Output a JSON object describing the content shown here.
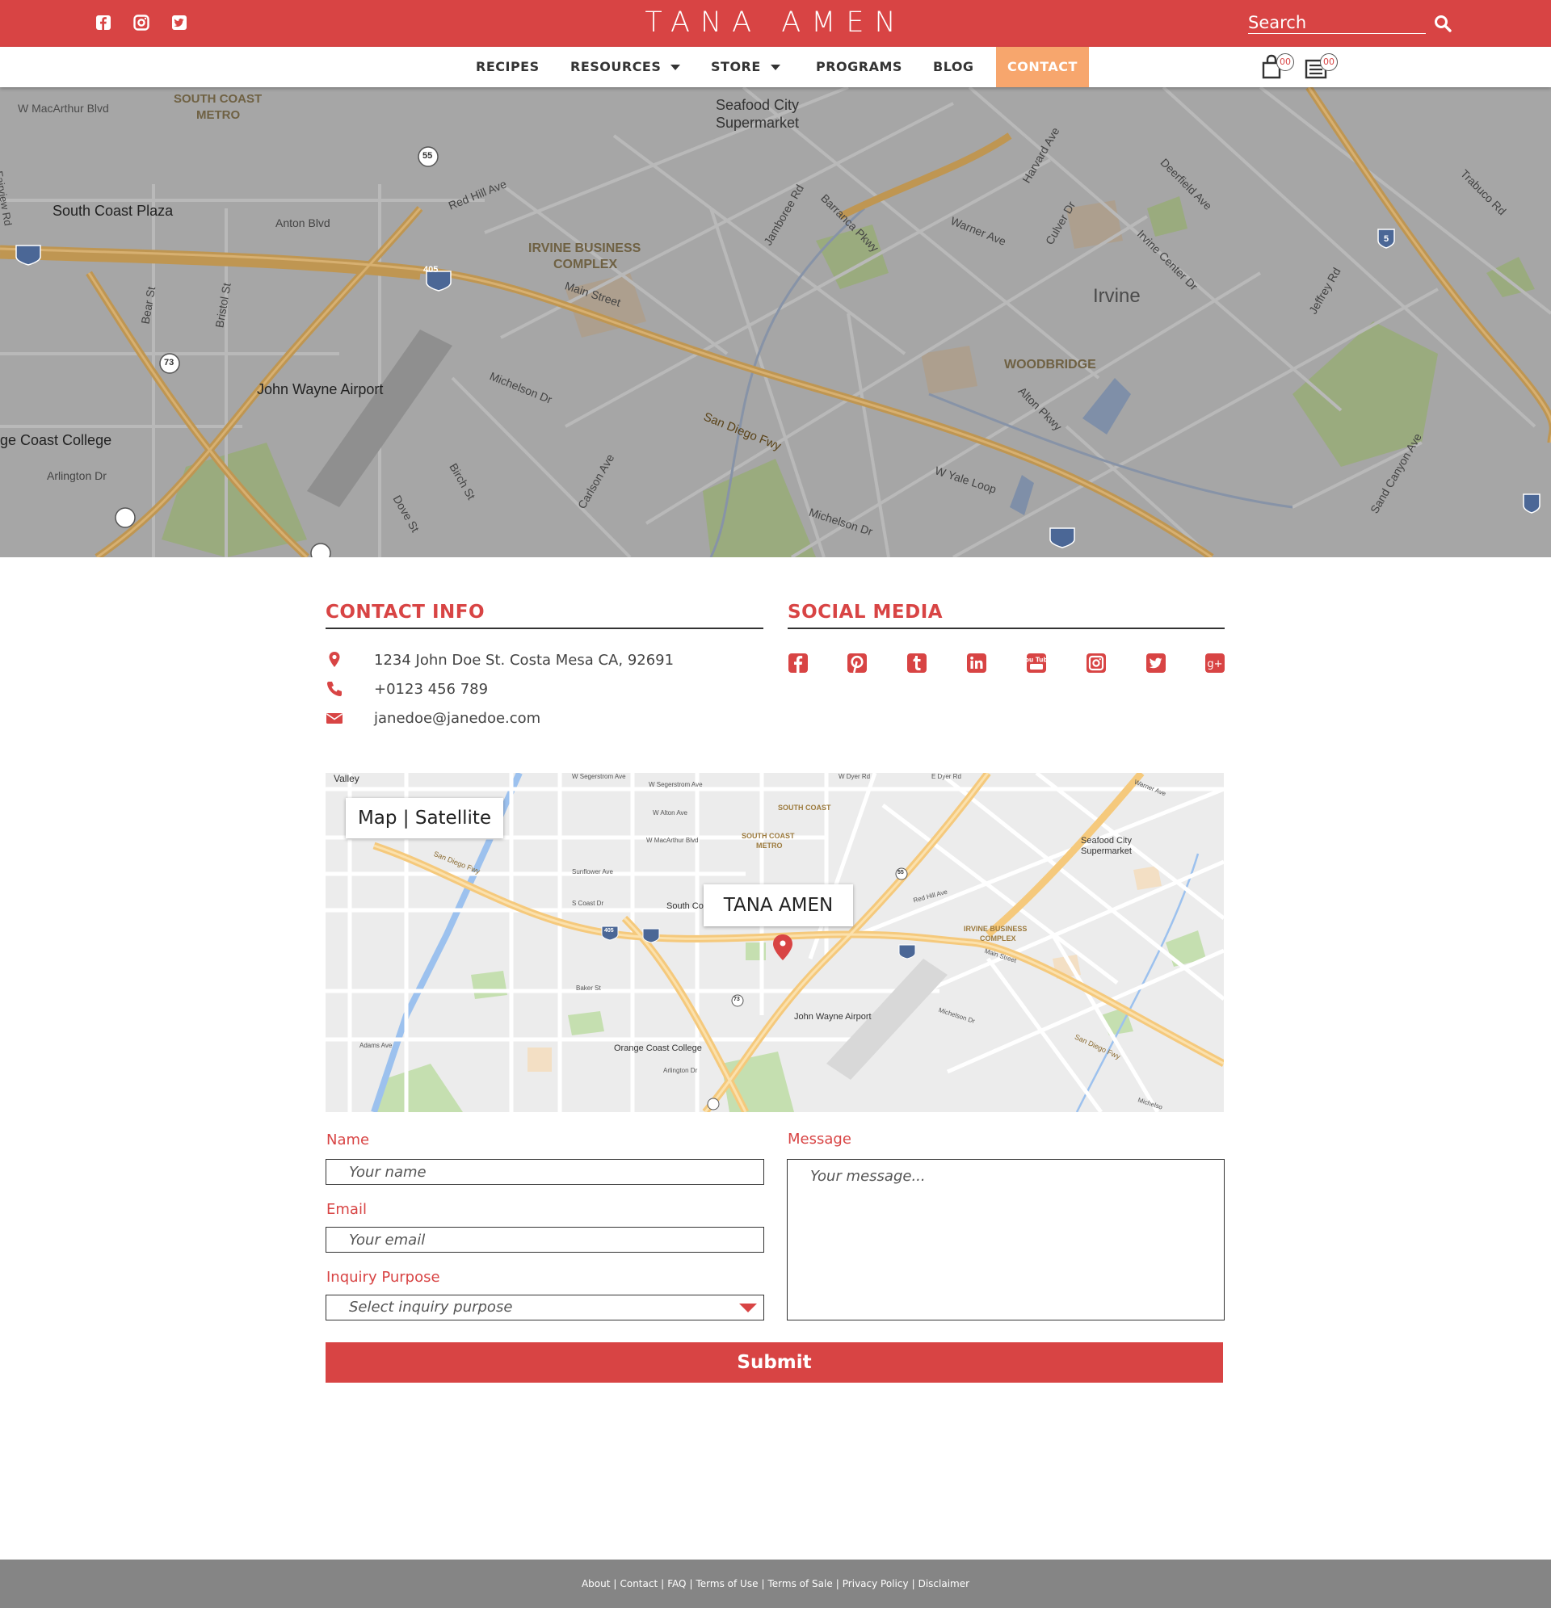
{
  "brand": "TANA AMEN",
  "header": {
    "social_icons": [
      "facebook-icon",
      "instagram-icon",
      "twitter-icon"
    ],
    "search_placeholder": "Search"
  },
  "nav": {
    "items": [
      {
        "label": "RECIPES",
        "dropdown": false
      },
      {
        "label": "RESOURCES",
        "dropdown": true
      },
      {
        "label": "STORE",
        "dropdown": true
      },
      {
        "label": "PROGRAMS",
        "dropdown": false
      },
      {
        "label": "BLOG",
        "dropdown": false
      },
      {
        "label": "CONTACT",
        "dropdown": false,
        "active": true
      }
    ],
    "cart_count": "00",
    "list_count": "00"
  },
  "hero_map": {
    "labels": {
      "macarthur": "W MacArthur Blvd",
      "scm1": "SOUTH COAST",
      "scm2": "METRO",
      "seafood1": "Seafood City",
      "seafood2": "Supermarket",
      "scplaza": "South Coast Plaza",
      "anton": "Anton Blvd",
      "redhill": "Red Hill Ave",
      "ibc1": "IRVINE BUSINESS",
      "ibc2": "COMPLEX",
      "main": "Main Street",
      "irvine": "Irvine",
      "woodbridge": "WOODBRIDGE",
      "airport": "John Wayne Airport",
      "michelson": "Michelson Dr",
      "sandiego": "San Diego Fwy",
      "occ": "ge Coast College",
      "arlington": "Arlington Dr",
      "wyale": "W Yale Loop",
      "alton": "Alton Pkwy",
      "jamboree": "Jamboree Rd",
      "barranca": "Barranca Pkwy",
      "harvard": "Harvard Ave",
      "culver": "Culver Dr",
      "deerfield": "Deerfield Ave",
      "trabuco": "Trabuco Rd",
      "jeffrey": "Jeffrey Rd",
      "sandcanyon": "Sand Canyon Ave",
      "bearst": "Bear St",
      "bristol": "Bristol St",
      "birch": "Birch St",
      "dove": "Dove St",
      "carlson": "Carlson Ave",
      "warner": "Warner Ave",
      "icd": "Irvine Center Dr",
      "michelson2": "Michelson Dr",
      "fairview": "Fairview Rd"
    },
    "shields": {
      "i405": "405",
      "r55": "55",
      "r73": "73",
      "i5": "5"
    }
  },
  "contact_info": {
    "title": "CONTACT INFO",
    "address": "1234 John Doe St. Costa Mesa CA, 92691",
    "phone": "+0123 456 789",
    "email": "janedoe@janedoe.com"
  },
  "social_media": {
    "title": "SOCIAL MEDIA",
    "icons": [
      "facebook-icon",
      "pinterest-icon",
      "tumblr-icon",
      "linkedin-icon",
      "youtube-icon",
      "instagram-icon",
      "twitter-icon",
      "google-plus-icon"
    ],
    "youtube_text": "You Tube",
    "gplus_text": "g+"
  },
  "mini_map": {
    "toggle_label": "Map | Satellite",
    "pin_label": "TANA AMEN",
    "labels": {
      "valley": "Valley",
      "segerstrom": "W Segerstrom Ave",
      "segerstrom2": "W Segerstrom Ave",
      "dyer": "W Dyer Rd",
      "edyer": "E Dyer Rd",
      "warner": "Warner Ave",
      "walton": "W Alton Ave",
      "scm1": "SOUTH COAST",
      "scm1b": "SOUTH COAST",
      "scm2": "METRO",
      "macarthur": "W MacArthur Blvd",
      "seafood1": "Seafood City",
      "seafood2": "Supermarket",
      "sandiego": "San Diego Fwy",
      "sunflower": "Sunflower Ave",
      "scoast": "S Coast Dr",
      "southco": "South Co",
      "redhill": "Red Hill Ave",
      "ibc1": "IRVINE BUSINESS",
      "ibc2": "COMPLEX",
      "main": "Main Street",
      "baker": "Baker St",
      "adams": "Adams Ave",
      "airport": "John Wayne Airport",
      "michelson": "Michelson Dr",
      "occ": "Orange Coast College",
      "arlington": "Arlington Dr",
      "sandiego2": "San Diego Fwy",
      "michelson2": "Michelso",
      "shield405": "405",
      "shield55": "55",
      "shield73": "73"
    }
  },
  "form": {
    "name_label": "Name",
    "name_placeholder": "Your name",
    "email_label": "Email",
    "email_placeholder": "Your email",
    "purpose_label": "Inquiry Purpose",
    "purpose_value": "Select inquiry purpose",
    "message_label": "Message",
    "message_placeholder": "Your message...",
    "submit_label": "Submit"
  },
  "footer": {
    "links": [
      "About",
      "Contact",
      "FAQ",
      "Terms of Use",
      "Terms of Sale",
      "Privacy Policy",
      "Disclaimer"
    ],
    "separator": "|"
  },
  "colors": {
    "brand_red": "#d84444",
    "contact_highlight": "#f7a66d",
    "footer_gray": "#858585"
  }
}
